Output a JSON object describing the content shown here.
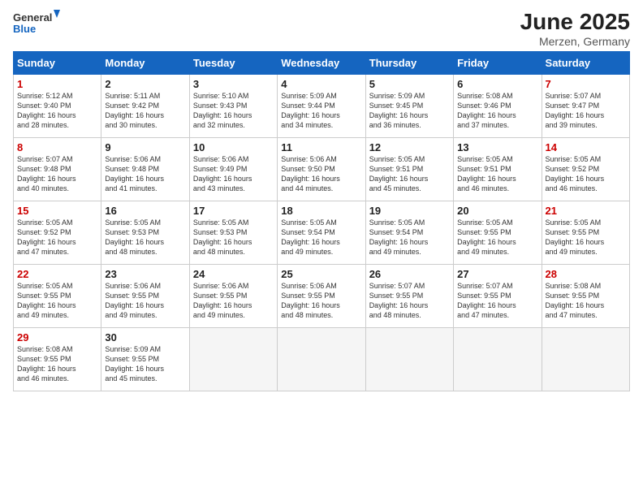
{
  "header": {
    "logo_general": "General",
    "logo_blue": "Blue",
    "title": "June 2025",
    "subtitle": "Merzen, Germany"
  },
  "weekdays": [
    "Sunday",
    "Monday",
    "Tuesday",
    "Wednesday",
    "Thursday",
    "Friday",
    "Saturday"
  ],
  "weeks": [
    [
      {
        "day": "1",
        "info": "Sunrise: 5:12 AM\nSunset: 9:40 PM\nDaylight: 16 hours\nand 28 minutes."
      },
      {
        "day": "2",
        "info": "Sunrise: 5:11 AM\nSunset: 9:42 PM\nDaylight: 16 hours\nand 30 minutes."
      },
      {
        "day": "3",
        "info": "Sunrise: 5:10 AM\nSunset: 9:43 PM\nDaylight: 16 hours\nand 32 minutes."
      },
      {
        "day": "4",
        "info": "Sunrise: 5:09 AM\nSunset: 9:44 PM\nDaylight: 16 hours\nand 34 minutes."
      },
      {
        "day": "5",
        "info": "Sunrise: 5:09 AM\nSunset: 9:45 PM\nDaylight: 16 hours\nand 36 minutes."
      },
      {
        "day": "6",
        "info": "Sunrise: 5:08 AM\nSunset: 9:46 PM\nDaylight: 16 hours\nand 37 minutes."
      },
      {
        "day": "7",
        "info": "Sunrise: 5:07 AM\nSunset: 9:47 PM\nDaylight: 16 hours\nand 39 minutes."
      }
    ],
    [
      {
        "day": "8",
        "info": "Sunrise: 5:07 AM\nSunset: 9:48 PM\nDaylight: 16 hours\nand 40 minutes."
      },
      {
        "day": "9",
        "info": "Sunrise: 5:06 AM\nSunset: 9:48 PM\nDaylight: 16 hours\nand 41 minutes."
      },
      {
        "day": "10",
        "info": "Sunrise: 5:06 AM\nSunset: 9:49 PM\nDaylight: 16 hours\nand 43 minutes."
      },
      {
        "day": "11",
        "info": "Sunrise: 5:06 AM\nSunset: 9:50 PM\nDaylight: 16 hours\nand 44 minutes."
      },
      {
        "day": "12",
        "info": "Sunrise: 5:05 AM\nSunset: 9:51 PM\nDaylight: 16 hours\nand 45 minutes."
      },
      {
        "day": "13",
        "info": "Sunrise: 5:05 AM\nSunset: 9:51 PM\nDaylight: 16 hours\nand 46 minutes."
      },
      {
        "day": "14",
        "info": "Sunrise: 5:05 AM\nSunset: 9:52 PM\nDaylight: 16 hours\nand 46 minutes."
      }
    ],
    [
      {
        "day": "15",
        "info": "Sunrise: 5:05 AM\nSunset: 9:52 PM\nDaylight: 16 hours\nand 47 minutes."
      },
      {
        "day": "16",
        "info": "Sunrise: 5:05 AM\nSunset: 9:53 PM\nDaylight: 16 hours\nand 48 minutes."
      },
      {
        "day": "17",
        "info": "Sunrise: 5:05 AM\nSunset: 9:53 PM\nDaylight: 16 hours\nand 48 minutes."
      },
      {
        "day": "18",
        "info": "Sunrise: 5:05 AM\nSunset: 9:54 PM\nDaylight: 16 hours\nand 49 minutes."
      },
      {
        "day": "19",
        "info": "Sunrise: 5:05 AM\nSunset: 9:54 PM\nDaylight: 16 hours\nand 49 minutes."
      },
      {
        "day": "20",
        "info": "Sunrise: 5:05 AM\nSunset: 9:55 PM\nDaylight: 16 hours\nand 49 minutes."
      },
      {
        "day": "21",
        "info": "Sunrise: 5:05 AM\nSunset: 9:55 PM\nDaylight: 16 hours\nand 49 minutes."
      }
    ],
    [
      {
        "day": "22",
        "info": "Sunrise: 5:05 AM\nSunset: 9:55 PM\nDaylight: 16 hours\nand 49 minutes."
      },
      {
        "day": "23",
        "info": "Sunrise: 5:06 AM\nSunset: 9:55 PM\nDaylight: 16 hours\nand 49 minutes."
      },
      {
        "day": "24",
        "info": "Sunrise: 5:06 AM\nSunset: 9:55 PM\nDaylight: 16 hours\nand 49 minutes."
      },
      {
        "day": "25",
        "info": "Sunrise: 5:06 AM\nSunset: 9:55 PM\nDaylight: 16 hours\nand 48 minutes."
      },
      {
        "day": "26",
        "info": "Sunrise: 5:07 AM\nSunset: 9:55 PM\nDaylight: 16 hours\nand 48 minutes."
      },
      {
        "day": "27",
        "info": "Sunrise: 5:07 AM\nSunset: 9:55 PM\nDaylight: 16 hours\nand 47 minutes."
      },
      {
        "day": "28",
        "info": "Sunrise: 5:08 AM\nSunset: 9:55 PM\nDaylight: 16 hours\nand 47 minutes."
      }
    ],
    [
      {
        "day": "29",
        "info": "Sunrise: 5:08 AM\nSunset: 9:55 PM\nDaylight: 16 hours\nand 46 minutes."
      },
      {
        "day": "30",
        "info": "Sunrise: 5:09 AM\nSunset: 9:55 PM\nDaylight: 16 hours\nand 45 minutes."
      },
      {
        "day": "",
        "info": ""
      },
      {
        "day": "",
        "info": ""
      },
      {
        "day": "",
        "info": ""
      },
      {
        "day": "",
        "info": ""
      },
      {
        "day": "",
        "info": ""
      }
    ]
  ]
}
